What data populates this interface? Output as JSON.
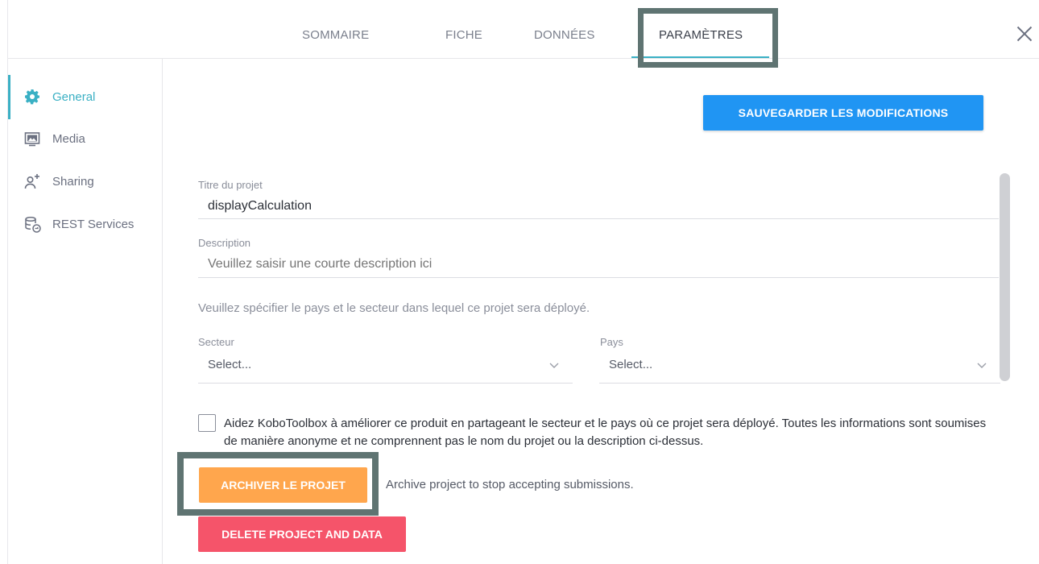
{
  "tabs": [
    {
      "label": "SOMMAIRE"
    },
    {
      "label": "FICHE"
    },
    {
      "label": "DONNÉES"
    },
    {
      "label": "PARAMÈTRES",
      "active": true
    }
  ],
  "sidebar": {
    "items": [
      {
        "label": "General",
        "icon": "gear-icon",
        "active": true
      },
      {
        "label": "Media",
        "icon": "media-icon"
      },
      {
        "label": "Sharing",
        "icon": "add-user-icon"
      },
      {
        "label": "REST Services",
        "icon": "database-sync-icon"
      }
    ]
  },
  "main": {
    "save_label": "SAUVEGARDER LES MODIFICATIONS",
    "title_label": "Titre du projet",
    "title_value": "displayCalculation",
    "description_label": "Description",
    "description_placeholder": "Veuillez saisir une courte description ici",
    "hint": "Veuillez spécifier le pays et le secteur dans lequel ce projet sera déployé.",
    "sector_label": "Secteur",
    "sector_value": "Select...",
    "country_label": "Pays",
    "country_value": "Select...",
    "checkbox_text": "Aidez KoboToolbox à améliorer ce produit en partageant le secteur et le pays où ce projet sera déployé. Toutes les informations sont soumises de manière anonyme et ne comprennent pas le nom du projet ou la description ci-dessus.",
    "checkbox_checked": false,
    "archive_label": "ARCHIVER LE PROJET",
    "archive_description": "Archive project to stop accepting submissions.",
    "delete_label": "DELETE PROJECT AND DATA"
  },
  "colors": {
    "accent": "#3ab0c4",
    "primary_button": "#2095f3",
    "archive_button": "#ffa64d",
    "delete_button": "#f5546a",
    "highlight_frame": "#5f7472"
  }
}
